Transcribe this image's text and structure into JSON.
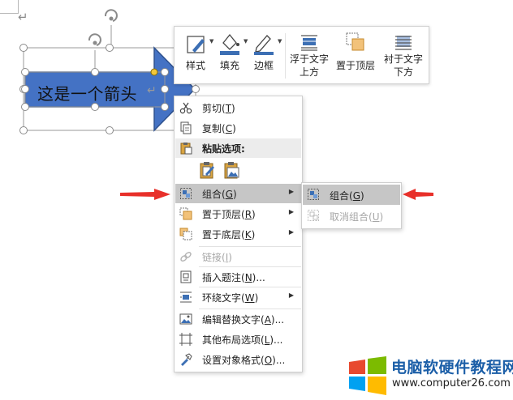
{
  "shape": {
    "text": "这是一个箭头",
    "paragraph_mark": "↵",
    "fill_color": "#4472c4",
    "border_color": "#2f528f"
  },
  "page": {
    "paragraph_mark": "↵"
  },
  "toolbar": {
    "buttons": [
      {
        "label": "样式",
        "icon": "style-icon"
      },
      {
        "label": "填充",
        "icon": "fill-icon"
      },
      {
        "label": "边框",
        "icon": "outline-icon"
      },
      {
        "label": "浮于文字上方",
        "icon": "in-front-of-text-icon"
      },
      {
        "label": "置于顶层",
        "icon": "bring-to-front-icon"
      },
      {
        "label": "衬于文字下方",
        "icon": "behind-text-icon"
      }
    ]
  },
  "context_menu": {
    "items": [
      {
        "label_pre": "剪切(",
        "key": "T",
        "label_post": ")",
        "icon": "scissors-icon"
      },
      {
        "label_pre": "复制(",
        "key": "C",
        "label_post": ")",
        "icon": "copy-icon"
      },
      {
        "label": "粘贴选项:",
        "icon": "paste-icon"
      },
      {
        "label_pre": "组合(",
        "key": "G",
        "label_post": ")",
        "icon": "group-icon",
        "highlighted": true
      },
      {
        "label_pre": "置于顶层(",
        "key": "R",
        "label_post": ")",
        "icon": "bring-to-front-icon"
      },
      {
        "label_pre": "置于底层(",
        "key": "K",
        "label_post": ")",
        "icon": "send-to-back-icon"
      },
      {
        "label_pre": "链接(",
        "key": "I",
        "label_post": ")",
        "icon": "link-icon",
        "disabled": true
      },
      {
        "label_pre": "插入题注(",
        "key": "N",
        "label_post": ")...",
        "icon": "caption-icon"
      },
      {
        "label_pre": "环绕文字(",
        "key": "W",
        "label_post": ")",
        "icon": "wrap-text-icon"
      },
      {
        "label_pre": "编辑替换文字(",
        "key": "A",
        "label_post": ")...",
        "icon": "alt-text-icon"
      },
      {
        "label_pre": "其他布局选项(",
        "key": "L",
        "label_post": ")...",
        "icon": "layout-options-icon"
      },
      {
        "label_pre": "设置对象格式(",
        "key": "O",
        "label_post": ")...",
        "icon": "format-object-icon"
      }
    ]
  },
  "submenu": {
    "items": [
      {
        "label_pre": "组合(",
        "key": "G",
        "label_post": ")",
        "icon": "group-icon",
        "highlighted": true
      },
      {
        "label_pre": "取消组合(",
        "key": "U",
        "label_post": ")",
        "icon": "ungroup-icon",
        "disabled": true
      }
    ]
  },
  "annotation": {
    "arrow_color": "#e8302a"
  },
  "watermark": {
    "title": "电脑软硬件教程网",
    "url": "www.computer26.com",
    "logo_colors": [
      "#e8492f",
      "#7cbb00",
      "#00a1f1",
      "#ffbb00"
    ]
  }
}
